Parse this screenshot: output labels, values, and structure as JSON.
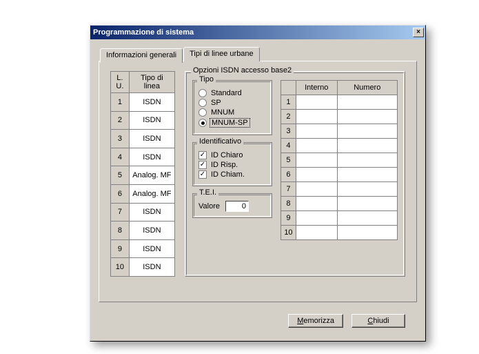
{
  "window": {
    "title": "Programmazione di sistema"
  },
  "tabs": {
    "t0": "Informazioni generali",
    "t1": "Tipi di linee urbane"
  },
  "linetable": {
    "h_lu": "L. U.",
    "h_tipo": "Tipo di linea",
    "rows": [
      {
        "n": "1",
        "tipo": "ISDN"
      },
      {
        "n": "2",
        "tipo": "ISDN"
      },
      {
        "n": "3",
        "tipo": "ISDN"
      },
      {
        "n": "4",
        "tipo": "ISDN"
      },
      {
        "n": "5",
        "tipo": "Analog. MF"
      },
      {
        "n": "6",
        "tipo": "Analog. MF"
      },
      {
        "n": "7",
        "tipo": "ISDN"
      },
      {
        "n": "8",
        "tipo": "ISDN"
      },
      {
        "n": "9",
        "tipo": "ISDN"
      },
      {
        "n": "10",
        "tipo": "ISDN"
      }
    ]
  },
  "opzioni": {
    "legend": "Opzioni ISDN accesso base2",
    "tipo": {
      "legend": "Tipo",
      "r0": "Standard",
      "r1": "SP",
      "r2": "MNUM",
      "r3": "MNUM-SP",
      "selected": "r3"
    },
    "ident": {
      "legend": "Identificativo",
      "c0": "ID Chiaro",
      "c1": "ID Risp.",
      "c2": "ID Chiam."
    },
    "tei": {
      "legend": "T.E.I.",
      "label": "Valore",
      "value": "0"
    },
    "grid": {
      "h_interno": "Interno",
      "h_numero": "Numero",
      "rownums": [
        "1",
        "2",
        "3",
        "4",
        "5",
        "6",
        "7",
        "8",
        "9",
        "10"
      ]
    }
  },
  "buttons": {
    "save_u": "M",
    "save_rest": "emorizza",
    "close_u": "C",
    "close_rest": "hiudi"
  }
}
